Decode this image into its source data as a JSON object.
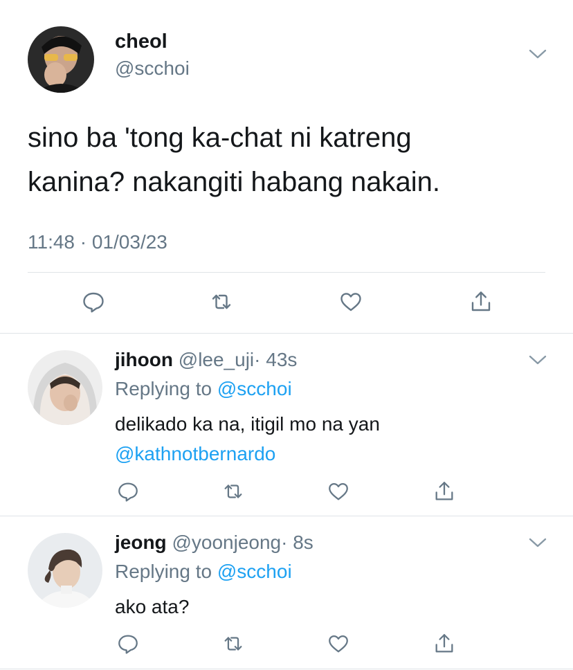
{
  "main_tweet": {
    "display_name": "cheol",
    "handle": "@scchoi",
    "text_line1": "sino ba 'tong ka-chat ni katreng",
    "text_line2": "kanina? nakangiti habang nakain.",
    "timestamp": "11:48 · 01/03/23"
  },
  "replies": [
    {
      "display_name": "jihoon",
      "handle": "@lee_uji",
      "time": "· 43s",
      "replying_prefix": "Replying to",
      "replying_handle": "@scchoi",
      "text": "delikado ka na, itigil mo na yan",
      "mention": "@kathnotbernardo"
    },
    {
      "display_name": "jeong",
      "handle": "@yoonjeong",
      "time": "· 8s",
      "replying_prefix": "Replying to",
      "replying_handle": "@scchoi",
      "text": "ako ata?"
    }
  ],
  "icons": {
    "reply": "reply-icon",
    "retweet": "retweet-icon",
    "like": "like-icon",
    "share": "share-icon",
    "more": "chevron-down-icon"
  },
  "colors": {
    "text": "#14171a",
    "secondary": "#657786",
    "link": "#1da1f2",
    "divider": "#dfe3e7"
  }
}
